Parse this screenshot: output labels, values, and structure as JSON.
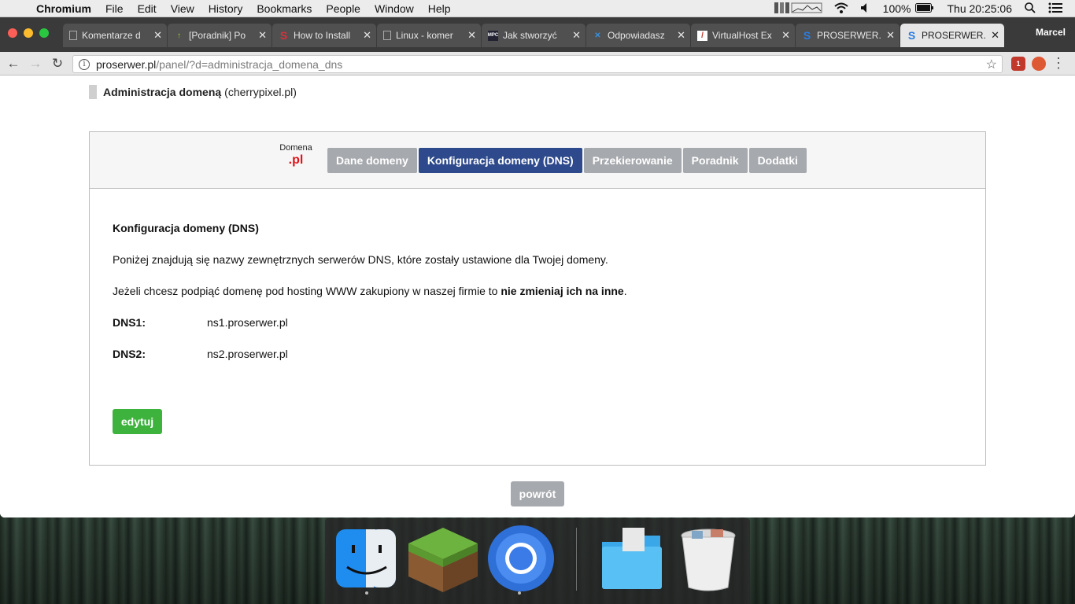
{
  "menubar": {
    "app": "Chromium",
    "items": [
      "File",
      "Edit",
      "View",
      "History",
      "Bookmarks",
      "People",
      "Window",
      "Help"
    ],
    "battery": "100%",
    "clock": "Thu 20:25:06"
  },
  "browser": {
    "profile": "Marcel",
    "url_host": "proserwer.pl",
    "url_path": "/panel/?d=administracja_domena_dns",
    "tabs": [
      {
        "title": "Komentarze d",
        "icon": "page-icon"
      },
      {
        "title": "[Poradnik] Po",
        "icon": "arrow-icon"
      },
      {
        "title": "How to Install",
        "icon": "s-logo-icon"
      },
      {
        "title": "Linux - komer",
        "icon": "page-icon"
      },
      {
        "title": "Jak stworzyć",
        "icon": "mpc-icon"
      },
      {
        "title": "Odpowiadasz",
        "icon": "wp-icon"
      },
      {
        "title": "VirtualHost Ex",
        "icon": "feather-icon"
      },
      {
        "title": "PROSERWER.",
        "icon": "proserwer-icon"
      },
      {
        "title": "PROSERWER.",
        "icon": "proserwer-icon"
      }
    ],
    "ext_badge": "1"
  },
  "page": {
    "breadcrumb_title": "Administracja domeną",
    "breadcrumb_domain": "(cherrypixel.pl)",
    "domain_label": "Domena",
    "domain_tld": ".pl",
    "nav_tabs": [
      "Dane domeny",
      "Konfiguracja domeny (DNS)",
      "Przekierowanie",
      "Poradnik",
      "Dodatki"
    ],
    "section_title": "Konfiguracja domeny (DNS)",
    "paragraph1": "Poniżej znajdują się nazwy zewnętrznych serwerów DNS, które zostały ustawione dla Twojej domeny.",
    "paragraph2_start": "Jeżeli chcesz podpiąć domenę pod hosting WWW zakupiony w naszej firmie to ",
    "paragraph2_bold": "nie zmieniaj ich na inne",
    "paragraph2_end": ".",
    "dns": [
      {
        "label": "DNS1:",
        "value": "ns1.proserwer.pl"
      },
      {
        "label": "DNS2:",
        "value": "ns2.proserwer.pl"
      }
    ],
    "edit_button": "edytuj",
    "back_button": "powrót"
  },
  "colors": {
    "active_tab": "#2e4a8c",
    "inactive_tab": "#a6a9ad",
    "edit_button": "#3db33d",
    "tld": "#e0121a"
  },
  "dock": [
    "Finder",
    "Minecraft",
    "Chromium",
    "Downloads",
    "Trash"
  ]
}
